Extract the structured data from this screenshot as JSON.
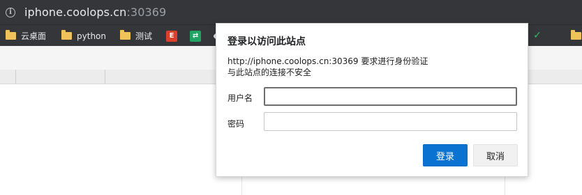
{
  "browser": {
    "url_host": "iphone.coolops.cn",
    "url_port": ":30369",
    "info_icon_glyph": "i"
  },
  "bookmarks": [
    {
      "label": "云桌面",
      "icon": "folder-icon"
    },
    {
      "label": "python",
      "icon": "folder-icon"
    },
    {
      "label": "测试",
      "icon": "folder-icon"
    }
  ],
  "favicons": [
    {
      "name": "red-e-favicon-icon",
      "glyph": "E",
      "color": "#d9412b"
    },
    {
      "name": "green-arrows-favicon-icon",
      "glyph": "⇄",
      "color": "#1fa463"
    },
    {
      "name": "white-cube-favicon-icon",
      "glyph": "",
      "color": "#e8eaed"
    },
    {
      "name": "green-favicon-icon",
      "glyph": "",
      "color": "#2ebf5f"
    }
  ],
  "dialog": {
    "title": "登录以访问此站点",
    "line1": "http://iphone.coolops.cn:30369 要求进行身份验证",
    "line2": "与此站点的连接不安全",
    "username_label": "用户名",
    "password_label": "密码",
    "username_value": "",
    "password_value": "",
    "login_button": "登录",
    "cancel_button": "取消"
  },
  "colors": {
    "chrome_dark": "#35363a",
    "primary_button": "#0a73d2",
    "folder": "#f0c35a"
  }
}
